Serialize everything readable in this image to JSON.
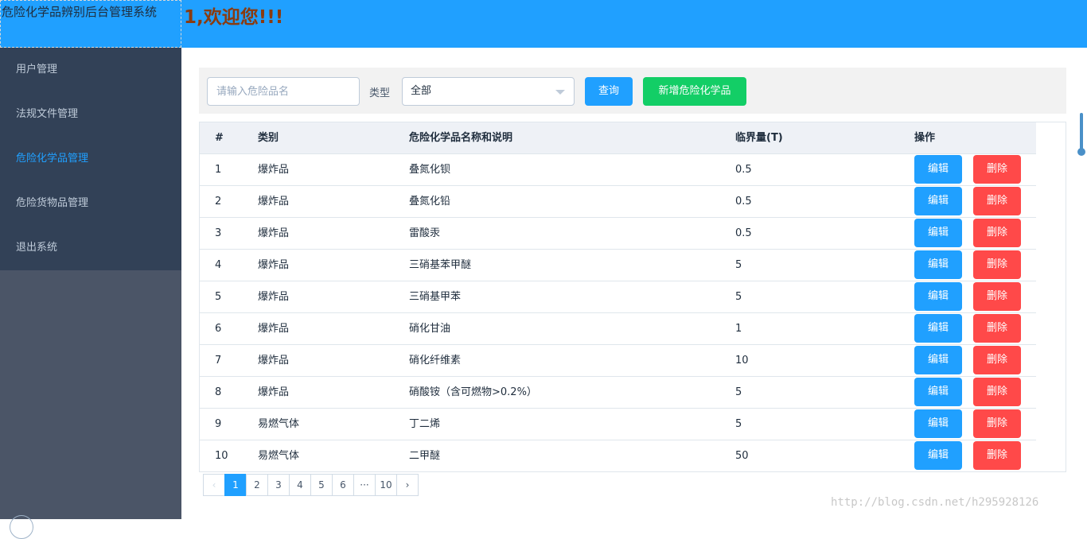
{
  "header": {
    "system_title": "危险化学品辨别后台管理系统",
    "welcome": "1,欢迎您!!!"
  },
  "sidebar": {
    "items": [
      {
        "label": "用户管理"
      },
      {
        "label": "法规文件管理"
      },
      {
        "label": "危险化学品管理",
        "active": true
      },
      {
        "label": "危险货物品管理"
      },
      {
        "label": "退出系统"
      }
    ]
  },
  "filter": {
    "search_placeholder": "请输入危险品名",
    "search_value": "",
    "type_label": "类型",
    "type_selected": "全部",
    "query_label": "查询",
    "add_label": "新增危险化学品"
  },
  "table": {
    "headers": [
      "#",
      "类别",
      "危险化学品名称和说明",
      "临界量(T)",
      "操作"
    ],
    "edit_label": "编辑",
    "delete_label": "删除",
    "rows": [
      {
        "idx": "1",
        "category": "爆炸品",
        "name": "叠氮化钡",
        "qty": "0.5"
      },
      {
        "idx": "2",
        "category": "爆炸品",
        "name": "叠氮化铅",
        "qty": "0.5"
      },
      {
        "idx": "3",
        "category": "爆炸品",
        "name": "雷酸汞",
        "qty": "0.5"
      },
      {
        "idx": "4",
        "category": "爆炸品",
        "name": "三硝基苯甲醚",
        "qty": "5"
      },
      {
        "idx": "5",
        "category": "爆炸品",
        "name": "三硝基甲苯",
        "qty": "5"
      },
      {
        "idx": "6",
        "category": "爆炸品",
        "name": "硝化甘油",
        "qty": "1"
      },
      {
        "idx": "7",
        "category": "爆炸品",
        "name": "硝化纤维素",
        "qty": "10"
      },
      {
        "idx": "8",
        "category": "爆炸品",
        "name": "硝酸铵（含可燃物>0.2%）",
        "qty": "5"
      },
      {
        "idx": "9",
        "category": "易燃气体",
        "name": "丁二烯",
        "qty": "5"
      },
      {
        "idx": "10",
        "category": "易燃气体",
        "name": "二甲醚",
        "qty": "50"
      }
    ]
  },
  "pagination": {
    "prev": "‹",
    "next": "›",
    "pages": [
      "1",
      "2",
      "3",
      "4",
      "5",
      "6",
      "···",
      "10"
    ],
    "current": "1"
  },
  "watermark": "http://blog.csdn.net/h295928126",
  "colors": {
    "primary": "#20a0ff",
    "success": "#13ce66",
    "danger": "#ff4949",
    "sidebar": "#324157"
  }
}
